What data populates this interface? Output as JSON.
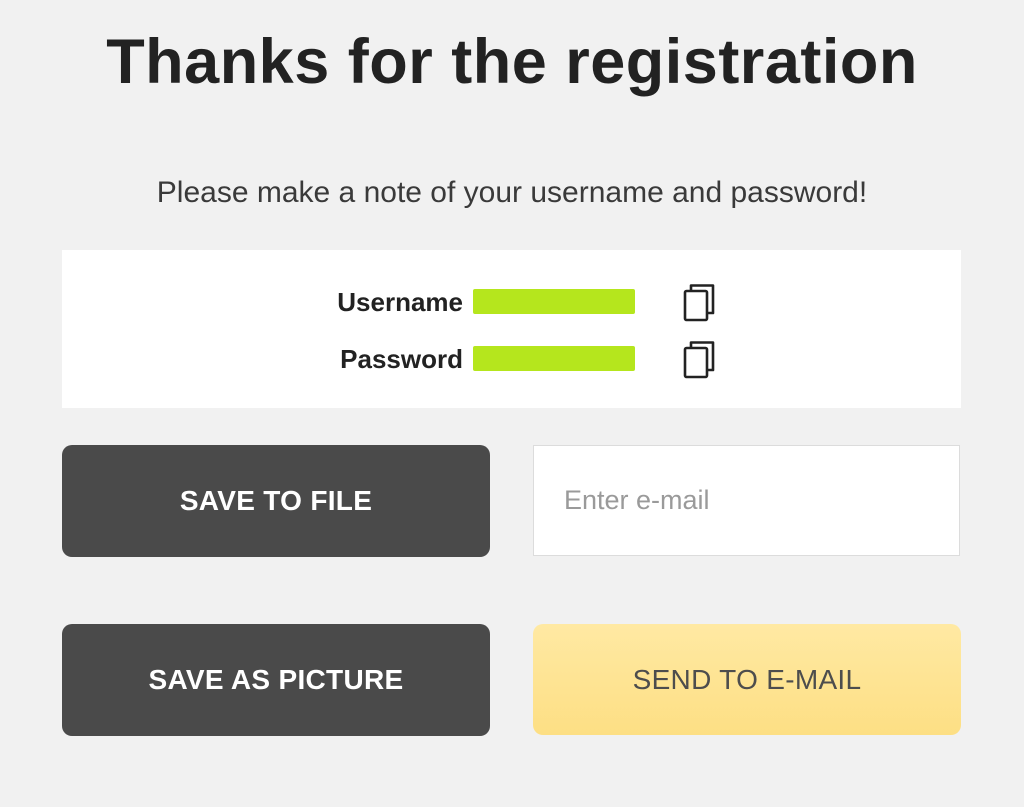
{
  "header": {
    "title": "Thanks for the registration",
    "subtitle": "Please make a note of your username and password!"
  },
  "credentials": {
    "username_label": "Username",
    "password_label": "Password",
    "redaction_color": "#b5e61d",
    "copy_icon": "copy-icon"
  },
  "actions": {
    "save_to_file_label": "SAVE TO FILE",
    "save_as_picture_label": "SAVE AS PICTURE",
    "send_to_email_label": "SEND TO E-MAIL",
    "email_placeholder": "Enter e-mail",
    "email_value": ""
  },
  "colors": {
    "background": "#f1f1f1",
    "dark_button": "#4a4a4a",
    "send_button": "#fde49a"
  }
}
